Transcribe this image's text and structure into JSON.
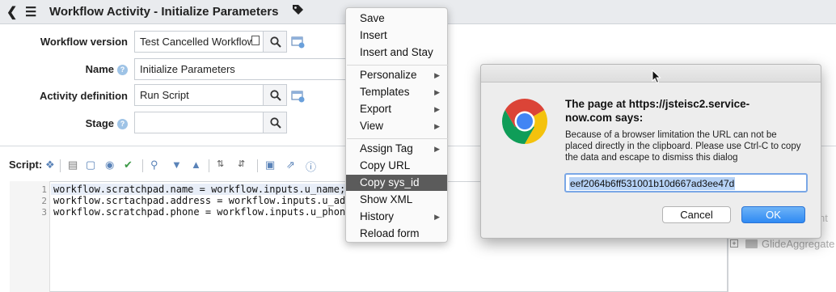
{
  "header": {
    "title": "Workflow Activity - Initialize Parameters"
  },
  "form": {
    "workflow_version": {
      "label": "Workflow version",
      "value": "Test Cancelled Workflow"
    },
    "name": {
      "label": "Name",
      "value": "Initialize Parameters"
    },
    "activity_definition": {
      "label": "Activity definition",
      "value": "Run Script"
    },
    "stage": {
      "label": "Stage",
      "value": ""
    },
    "help_glyph": "?"
  },
  "script": {
    "label": "Script:",
    "lines": [
      {
        "num": "1",
        "code": "workflow.scratchpad.name = workflow.inputs.u_name;"
      },
      {
        "num": "2",
        "code": "workflow.scrtachpad.address = workflow.inputs.u_ad"
      },
      {
        "num": "3",
        "code": "workflow.scratchpad.phone = workflow.inputs.u_phon"
      }
    ]
  },
  "context_menu": {
    "items": [
      {
        "label": "Save",
        "submenu": false
      },
      {
        "label": "Insert",
        "submenu": false
      },
      {
        "label": "Insert and Stay",
        "submenu": false
      },
      {
        "label": "Personalize",
        "submenu": true
      },
      {
        "label": "Templates",
        "submenu": true
      },
      {
        "label": "Export",
        "submenu": true
      },
      {
        "label": "View",
        "submenu": true
      },
      {
        "label": "Assign Tag",
        "submenu": true
      },
      {
        "label": "Copy URL",
        "submenu": false
      },
      {
        "label": "Copy sys_id",
        "submenu": false,
        "selected": true
      },
      {
        "label": "Show XML",
        "submenu": false
      },
      {
        "label": "History",
        "submenu": true
      },
      {
        "label": "Reload form",
        "submenu": false
      }
    ]
  },
  "dialog": {
    "title": "The page at https://jsteisc2.service-now.com says:",
    "message": "Because of a browser limitation the URL can not be placed directly in the clipboard.  Please use Ctrl-C to copy the data and escape to dismiss this dialog",
    "value": "eef2064b6ff531001b10d667ad3ee47d",
    "cancel_label": "Cancel",
    "ok_label": "OK"
  },
  "right_panel": {
    "faint_text": "nt",
    "tree_item": "GlideAggregate"
  },
  "colors": {
    "header_bg": "#e9ebee",
    "menu_selected": "#5b5b5b",
    "ok_button": "#2f8af3",
    "selection": "#b5d1f5"
  }
}
